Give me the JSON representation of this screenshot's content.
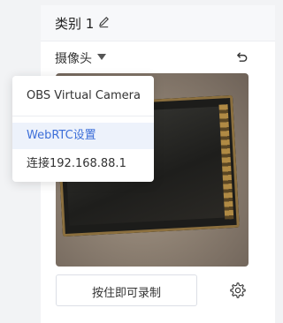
{
  "panel": {
    "title": "类别 1",
    "camera_label": "摄像头",
    "record_button": "按住即可录制"
  },
  "dropdown": {
    "items": [
      {
        "label": "OBS Virtual Camera",
        "selected": false
      },
      {
        "label": "WebRTC设置",
        "selected": true
      },
      {
        "label": "连接192.168.88.1",
        "selected": false
      }
    ]
  },
  "icons": {
    "edit": "pencil-icon",
    "caret": "caret-down-icon",
    "undo": "undo-icon",
    "settings": "gear-icon"
  },
  "colors": {
    "accent": "#3d6fd9",
    "selected_bg": "#edf2fb"
  }
}
